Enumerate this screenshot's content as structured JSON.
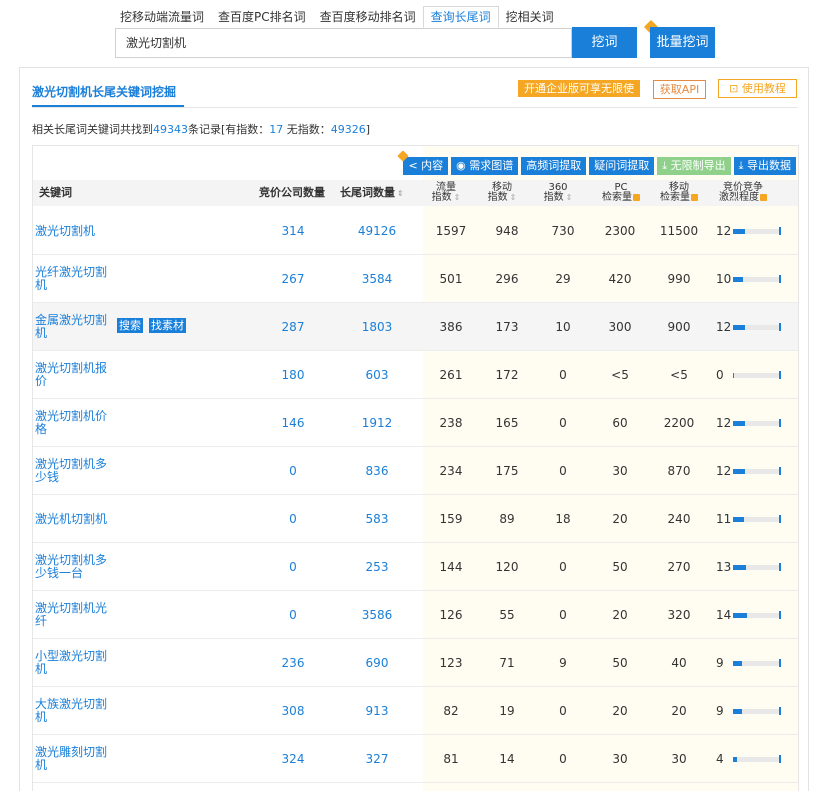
{
  "tabs": [
    {
      "label": "挖移动端流量词"
    },
    {
      "label": "查百度PC排名词"
    },
    {
      "label": "查百度移动排名词"
    },
    {
      "label": "查询长尾词",
      "active": true
    },
    {
      "label": "挖相关词"
    }
  ],
  "search": {
    "value": "激光切割机",
    "dig_label": "挖词",
    "batch_label": "批量挖词"
  },
  "panel": {
    "title": "激光切割机长尾关键词挖掘",
    "promo": "开通企业版可享无限使",
    "api_label": "获取API",
    "tutorial_label": "使用教程"
  },
  "summary": {
    "prefix": "相关长尾词关键词共找到",
    "total": "49343",
    "mid": "条记录[有指数：",
    "with_index": "17",
    "mid2": " 无指数：",
    "without_index": "49326",
    "suffix": "]"
  },
  "toolbar": {
    "content": "内容",
    "demand": "需求图谱",
    "highfreq": "高频词提取",
    "question": "疑问词提取",
    "unlimited": "无限制导出",
    "export": "导出数据"
  },
  "columns": {
    "keyword": "关键词",
    "bid_companies": "竞价公司数量",
    "longtail": "长尾词数量",
    "traffic_1": "流量",
    "traffic_2": "指数",
    "mobile_1": "移动",
    "mobile_2": "指数",
    "s360_1": "360",
    "s360_2": "指数",
    "pc_1": "PC",
    "pc_2": "检索量",
    "mob_1": "移动",
    "mob_2": "检索量",
    "comp_1": "竞价竞争",
    "comp_2": "激烈程度"
  },
  "row_actions": {
    "search": "搜索",
    "find": "找素材"
  },
  "rows": [
    {
      "keyword": "激光切割机",
      "bid": "314",
      "longtail": "49126",
      "traffic": "1597",
      "mobile": "948",
      "s360": "730",
      "pc": "2300",
      "mob": "11500",
      "comp": "12",
      "comp_level": 0.25
    },
    {
      "keyword": "光纤激光切割机",
      "bid": "267",
      "longtail": "3584",
      "traffic": "501",
      "mobile": "296",
      "s360": "29",
      "pc": "420",
      "mob": "990",
      "comp": "10",
      "comp_level": 0.21
    },
    {
      "keyword": "金属激光切割机",
      "bid": "287",
      "longtail": "1803",
      "traffic": "386",
      "mobile": "173",
      "s360": "10",
      "pc": "300",
      "mob": "900",
      "comp": "12",
      "comp_level": 0.25
    },
    {
      "keyword": "激光切割机报价",
      "bid": "180",
      "longtail": "603",
      "traffic": "261",
      "mobile": "172",
      "s360": "0",
      "pc": "<5",
      "mob": "<5",
      "comp": "0",
      "comp_level": 0.02
    },
    {
      "keyword": "激光切割机价格",
      "bid": "146",
      "longtail": "1912",
      "traffic": "238",
      "mobile": "165",
      "s360": "0",
      "pc": "60",
      "mob": "2200",
      "comp": "12",
      "comp_level": 0.25
    },
    {
      "keyword": "激光切割机多少钱",
      "bid": "0",
      "longtail": "836",
      "traffic": "234",
      "mobile": "175",
      "s360": "0",
      "pc": "30",
      "mob": "870",
      "comp": "12",
      "comp_level": 0.25
    },
    {
      "keyword": "激光机切割机",
      "bid": "0",
      "longtail": "583",
      "traffic": "159",
      "mobile": "89",
      "s360": "18",
      "pc": "20",
      "mob": "240",
      "comp": "11",
      "comp_level": 0.23
    },
    {
      "keyword": "激光切割机多少钱一台",
      "bid": "0",
      "longtail": "253",
      "traffic": "144",
      "mobile": "120",
      "s360": "0",
      "pc": "50",
      "mob": "270",
      "comp": "13",
      "comp_level": 0.27
    },
    {
      "keyword": "激光切割机光纤",
      "bid": "0",
      "longtail": "3586",
      "traffic": "126",
      "mobile": "55",
      "s360": "0",
      "pc": "20",
      "mob": "320",
      "comp": "14",
      "comp_level": 0.29
    },
    {
      "keyword": "小型激光切割机",
      "bid": "236",
      "longtail": "690",
      "traffic": "123",
      "mobile": "71",
      "s360": "9",
      "pc": "50",
      "mob": "40",
      "comp": "9",
      "comp_level": 0.19
    },
    {
      "keyword": "大族激光切割机",
      "bid": "308",
      "longtail": "913",
      "traffic": "82",
      "mobile": "19",
      "s360": "0",
      "pc": "20",
      "mob": "20",
      "comp": "9",
      "comp_level": 0.19
    },
    {
      "keyword": "激光雕刻切割机",
      "bid": "324",
      "longtail": "327",
      "traffic": "81",
      "mobile": "14",
      "s360": "0",
      "pc": "30",
      "mob": "30",
      "comp": "4",
      "comp_level": 0.08
    }
  ],
  "colors": {
    "accent": "#1a7fd9",
    "promo": "#f5a623",
    "api": "#e38a42",
    "green": "#8fd18a"
  }
}
